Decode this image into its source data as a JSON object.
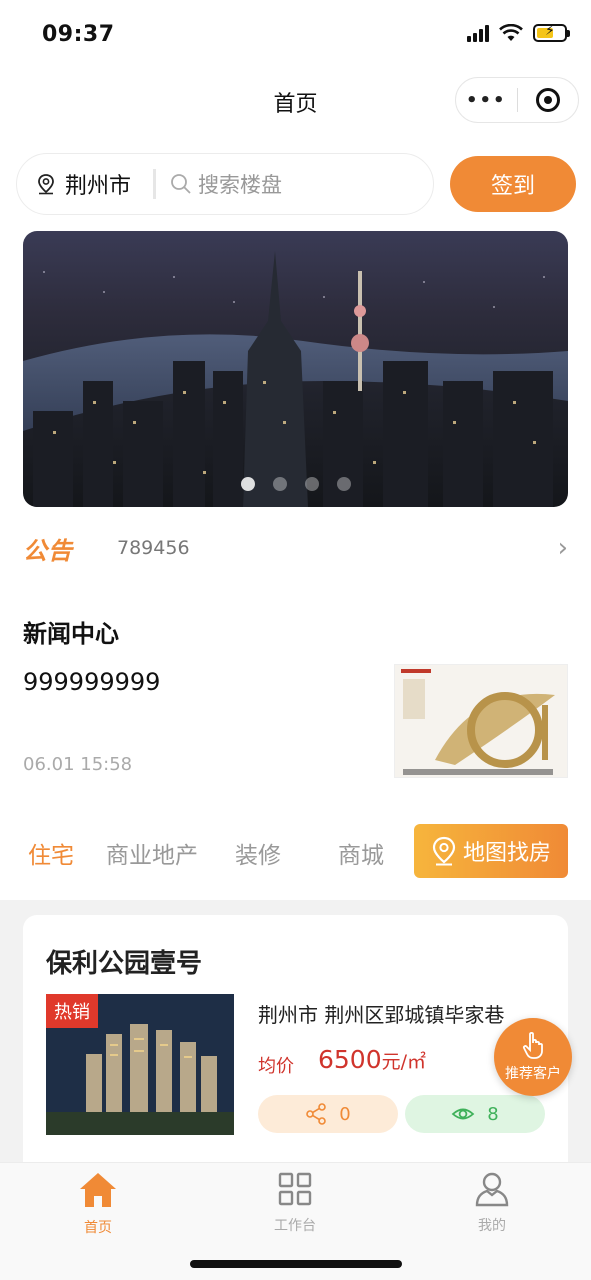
{
  "status_bar": {
    "time": "09:37"
  },
  "nav": {
    "title": "首页",
    "more_icon": "more-dots-icon",
    "close_icon": "target-icon"
  },
  "search": {
    "city": "荆州市",
    "placeholder": "搜索楼盘",
    "checkin_label": "签到"
  },
  "banner": {
    "slides": 4,
    "active_index": 0
  },
  "notice": {
    "logo_text": "公告",
    "text": "789456"
  },
  "news": {
    "section_title": "新闻中心",
    "headline": "999999999",
    "date": "06.01 15:58"
  },
  "categories": {
    "tabs": [
      "住宅",
      "商业地产",
      "装修",
      "商城"
    ],
    "active_index": 0,
    "map_button_label": "地图找房"
  },
  "listing": {
    "title": "保利公园壹号",
    "hot_badge": "热销",
    "address": "荆州市 荆州区郢城镇毕家巷",
    "price_label": "均价",
    "price_value": "6500",
    "price_unit": "元/㎡",
    "share_count": "0",
    "view_count": "8"
  },
  "recommend": {
    "label": "推荐客户"
  },
  "tab_bar": {
    "items": [
      {
        "label": "首页",
        "icon": "home-icon",
        "active": true
      },
      {
        "label": "工作台",
        "icon": "grid-icon",
        "active": false
      },
      {
        "label": "我的",
        "icon": "user-icon",
        "active": false
      }
    ]
  },
  "colors": {
    "accent": "#f08a36",
    "price": "#d0342c",
    "green": "#3fb15a"
  }
}
